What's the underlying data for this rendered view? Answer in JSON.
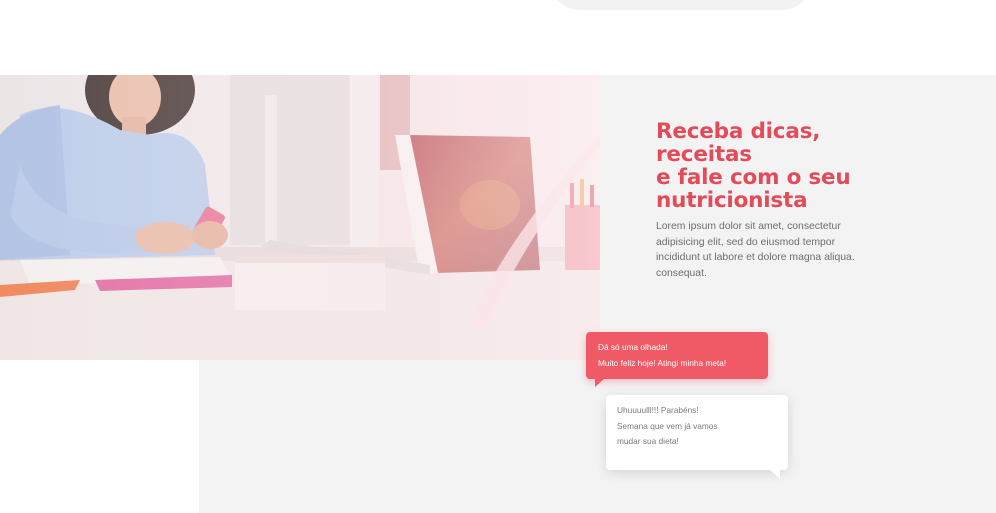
{
  "hero": {
    "headline_lines": [
      "Receba dicas,",
      "receitas",
      "e fale com o seu",
      "nutricionista"
    ],
    "description": "Lorem ipsum dolor sit amet, consectetur adipisicing elit, sed do eiusmod tempor incididunt ut labore et dolore magna aliqua. consequat.",
    "image": "woman-using-phone-at-desk-photo"
  },
  "chat": {
    "user_message": [
      "Dá só uma olhada!",
      "Muito feliz hoje! Atingi minha meta!"
    ],
    "nutritionist_reply": [
      "Uhuuuulll!!! Parabéns!",
      "Semana que vem já vamos",
      "mudar sua dieta!"
    ]
  },
  "colors": {
    "accent": "#e34b59",
    "bubble_red": "#f05a66",
    "panel_gray": "#f3f3f4",
    "body_text": "#6d6d6d"
  }
}
